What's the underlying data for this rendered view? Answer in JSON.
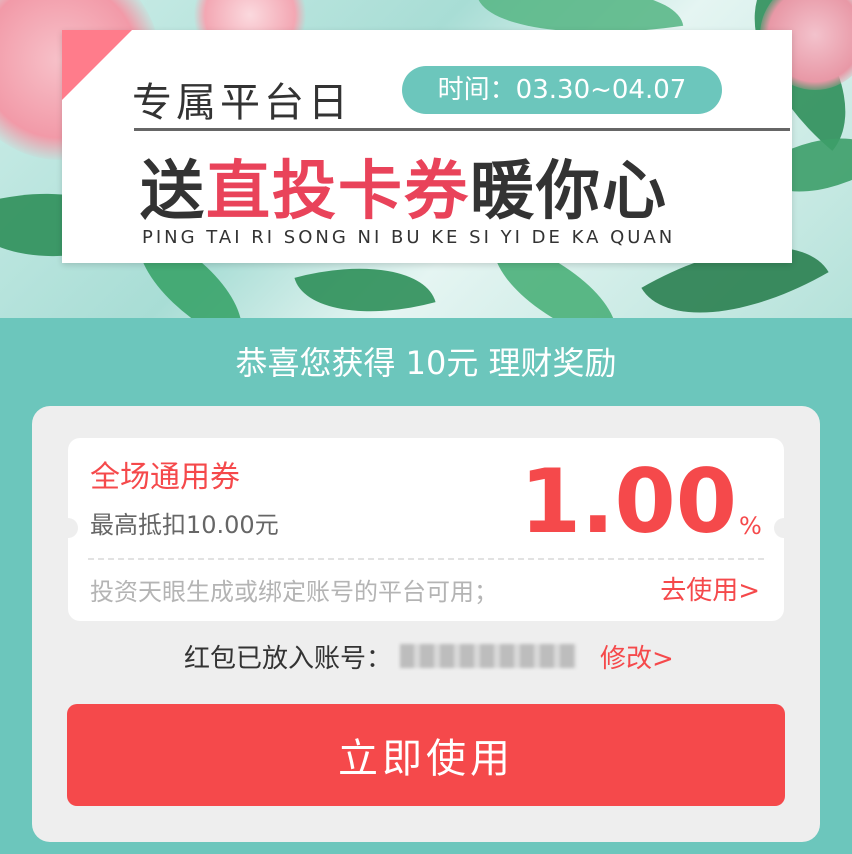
{
  "banner": {
    "title_small": "专属平台日",
    "date_range": "时间：03.30~04.07",
    "title_big_prefix": "送",
    "title_big_highlight": "直投卡券",
    "title_big_suffix": "暖你心",
    "pinyin": "PING TAI RI SONG NI BU KE SI YI DE KA QUAN"
  },
  "subtitle": "恭喜您获得 10元 理财奖励",
  "coupon": {
    "name": "全场通用券",
    "max_deduct": "最高抵扣10.00元",
    "amount": "1.00",
    "unit": "%",
    "description": "投资天眼生成或绑定账号的平台可用；",
    "use_link": "去使用>"
  },
  "account": {
    "label": "红包已放入账号：",
    "value": "",
    "edit_link": "修改>"
  },
  "use_button": "立即使用",
  "colors": {
    "teal": "#6cc6bc",
    "accent_red": "#f5494b",
    "panel_gray": "#eeeeee"
  }
}
